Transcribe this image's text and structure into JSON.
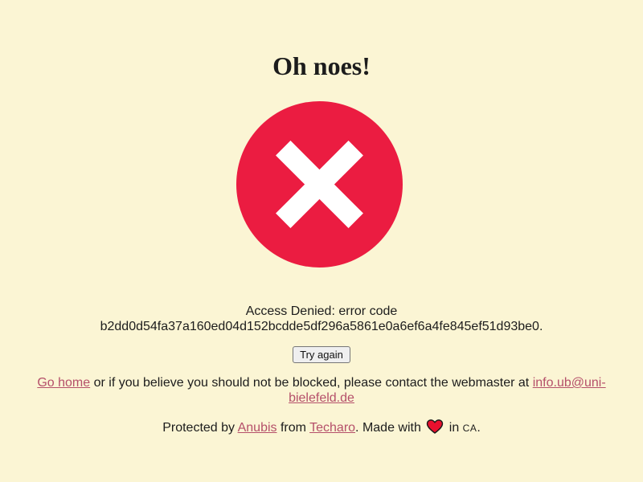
{
  "heading": "Oh noes!",
  "error_icon": {
    "name": "error-x-icon",
    "circle_color": "#eb1c41",
    "mark_color": "#ffffff"
  },
  "message": {
    "line1": "Access Denied: error code",
    "code": "b2dd0d54fa37a160ed04d152bcdde5df296a5861e0a6ef6a4fe845ef51d93be0."
  },
  "retry_button": "Try again",
  "contact": {
    "home_link": "Go home",
    "text": " or if you believe you should not be blocked, please contact the webmaster at ",
    "email_link": "info.ub@uni-bielefeld.de"
  },
  "footer": {
    "prefix": "Protected by ",
    "anubis_link": "Anubis",
    "from_text": " from ",
    "techaro_link": "Techaro",
    "made_with": ". Made with ",
    "heart_icon": "heart-icon",
    "in_text": " in ",
    "country": "CA",
    "end": "."
  },
  "colors": {
    "background": "#fbf5d4",
    "link": "#b5506a",
    "heart": "#e8102e"
  }
}
